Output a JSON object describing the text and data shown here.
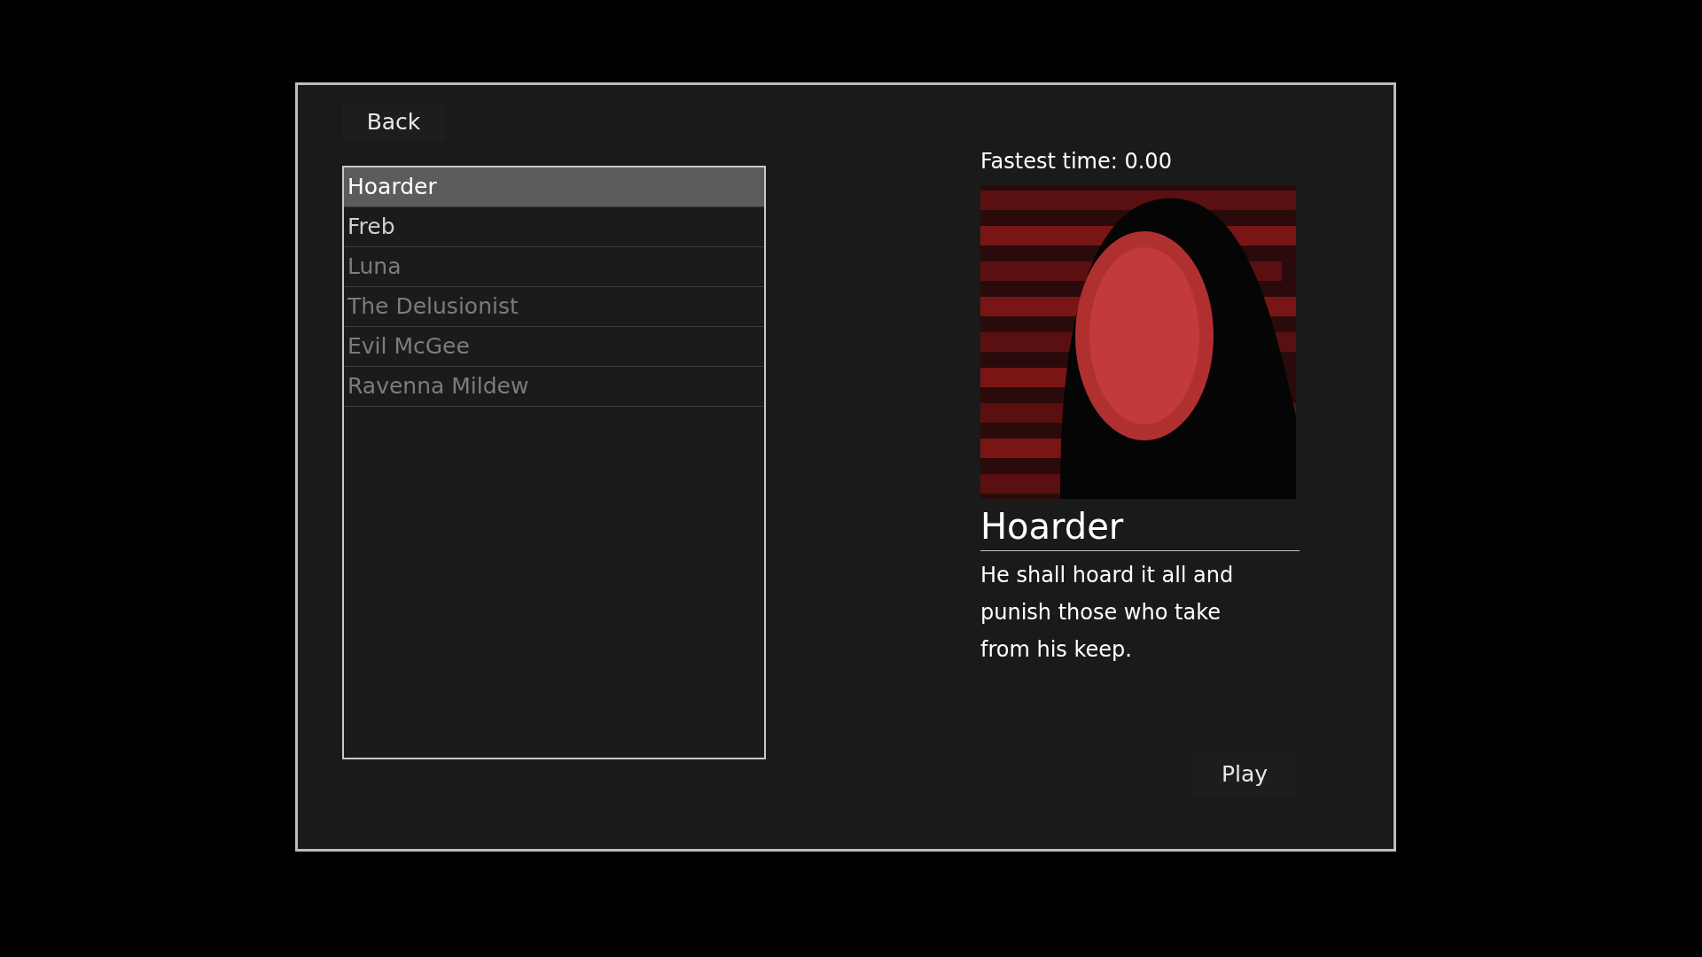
{
  "back_button": "Back",
  "characters": [
    {
      "label": "Hoarder",
      "selected": true,
      "disabled": false
    },
    {
      "label": "Freb",
      "selected": false,
      "disabled": false
    },
    {
      "label": "Luna",
      "selected": false,
      "disabled": true
    },
    {
      "label": "The Delusionist",
      "selected": false,
      "disabled": true
    },
    {
      "label": "Evil McGee",
      "selected": false,
      "disabled": true
    },
    {
      "label": "Ravenna Mildew",
      "selected": false,
      "disabled": true
    }
  ],
  "details": {
    "fastest_time": "Fastest time: 0.00",
    "name": "Hoarder",
    "description": "He shall hoard it all and punish those who take from his keep."
  },
  "play_button": "Play"
}
